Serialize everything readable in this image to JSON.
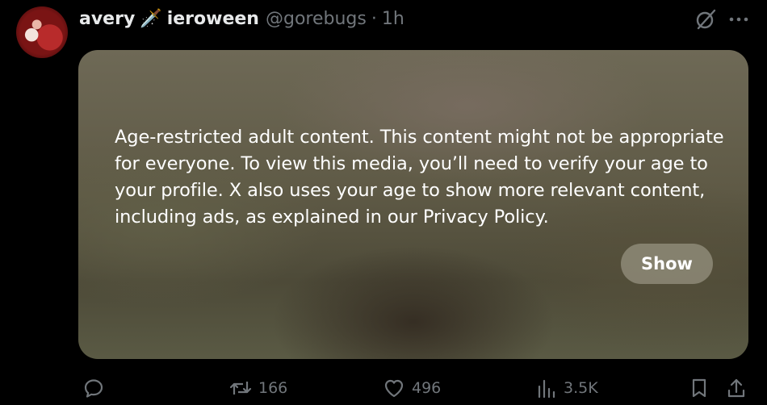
{
  "post": {
    "display_name_first": "avery",
    "name_emoji": "🗡️",
    "display_name_last": "ieroween",
    "handle": "@gorebugs",
    "separator": "·",
    "time": "1h"
  },
  "media": {
    "warning_text": "Age-restricted adult content. This content might not be appropriate for everyone. To view this media, you’ll need to verify your age to your profile. X also uses your age to show more relevant content, including ads, as explained in our Privacy Policy.",
    "show_label": "Show"
  },
  "actions": {
    "reposts": "166",
    "likes": "496",
    "views": "3.5K"
  },
  "icons": {
    "top": [
      "grok-icon",
      "more-icon"
    ],
    "bottom": [
      "reply-icon",
      "repost-icon",
      "like-icon",
      "views-icon",
      "bookmark-icon",
      "share-icon"
    ]
  },
  "colors": {
    "background": "#000000",
    "text": "#e7e9ea",
    "secondary": "#71767b",
    "show_button": "#969180"
  }
}
